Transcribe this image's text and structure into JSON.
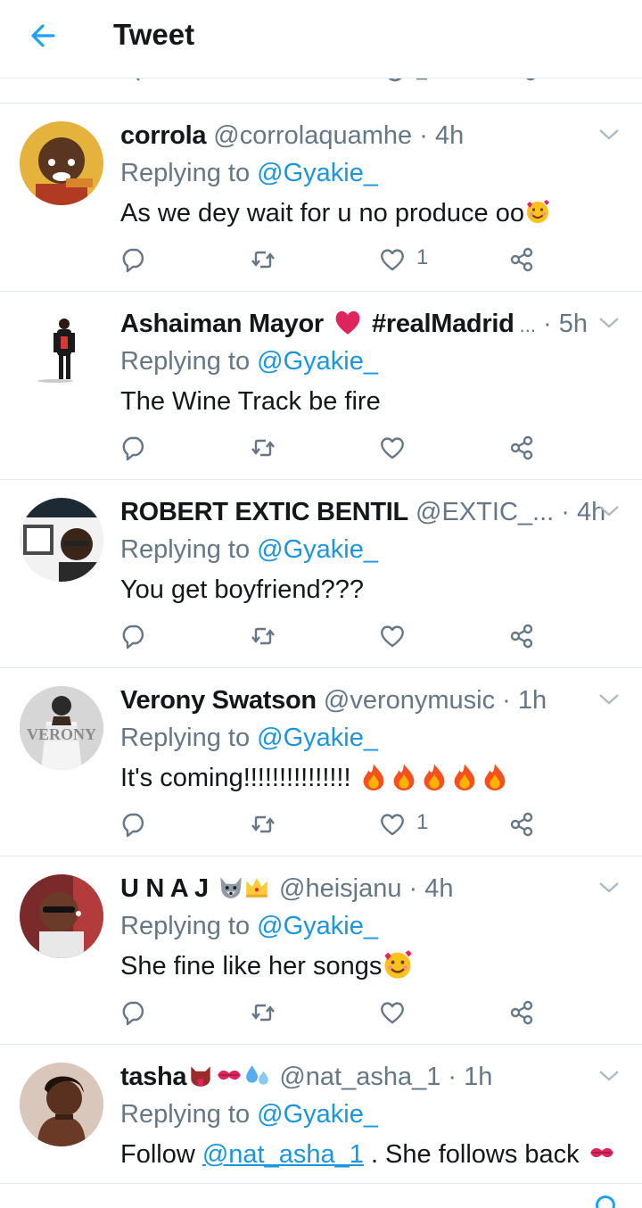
{
  "header": {
    "title": "Tweet",
    "back_icon": "arrow-left-icon",
    "accent": "#1da1f2"
  },
  "colors": {
    "link": "#1b95e0",
    "secondary": "#657786",
    "divider": "#e1e8ed"
  },
  "tweets": [
    {
      "name": "corrola",
      "handle": "@corrolaquamhe",
      "sep": " · ",
      "time": "4h",
      "replying_prefix": "Replying to ",
      "replying_to": "@Gyakie_",
      "text": "As we dey wait for u no produce oo",
      "text_emoji": "smiling-face-with-hearts",
      "likes": "1"
    },
    {
      "name": "Ashaiman Mayor",
      "name_emoji": "red-heart",
      "name_suffix": " #realMadrid",
      "ellipsis": " ...",
      "sep": " · ",
      "time": "5h",
      "replying_prefix": "Replying to ",
      "replying_to": "@Gyakie_",
      "text": "The Wine Track be fire",
      "likes": ""
    },
    {
      "name": "ROBERT EXTIC BENTIL",
      "handle": "@EXTIC_...",
      "sep": " · ",
      "time": "4h",
      "replying_prefix": "Replying to ",
      "replying_to": "@Gyakie_",
      "text": "You get boyfriend???",
      "likes": ""
    },
    {
      "name": "Verony Swatson",
      "handle": "@veronymusic",
      "sep": " · ",
      "time": "1h",
      "replying_prefix": "Replying to ",
      "replying_to": "@Gyakie_",
      "text": "It's coming!!!!!!!!!!!!!!! ",
      "text_emoji": "fire",
      "likes": "1"
    },
    {
      "name": "U N A J",
      "name_emoji": "wolf crown",
      "sep": " · ",
      "handle": "@heisjanu",
      "time": "4h",
      "replying_prefix": "Replying to ",
      "replying_to": "@Gyakie_",
      "text": "She fine like her songs",
      "text_emoji": "smiling-face-with-hearts",
      "likes": ""
    },
    {
      "name": "tasha",
      "name_emoji": "devil tongue kiss droplets",
      "handle": "@nat_asha_1",
      "sep": " · ",
      "time": "1h",
      "replying_prefix": "Replying to ",
      "replying_to": "@Gyakie_",
      "text_prefix": "Follow ",
      "text_link": "@nat_asha_1",
      "text": " . She follows back ",
      "text_emoji": "kiss-mark",
      "likes": ""
    }
  ]
}
